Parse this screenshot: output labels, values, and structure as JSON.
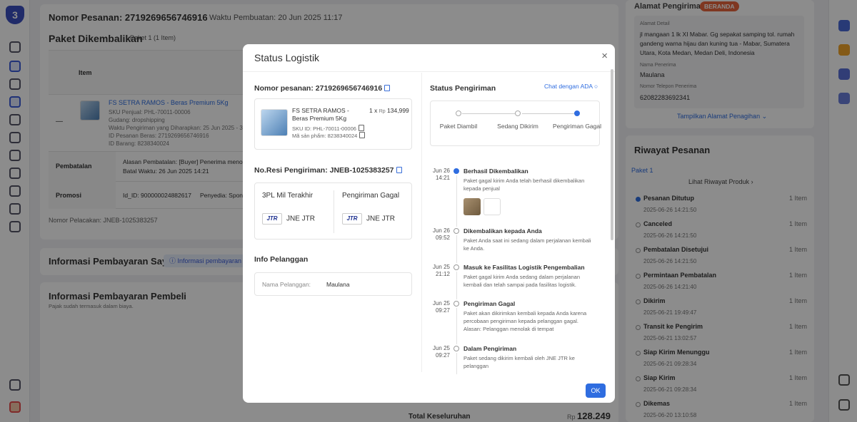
{
  "background": {
    "order": {
      "number_label": "Nomor Pesanan: 2719269656746916",
      "created": "Waktu Pembuatan: 20 Jun 2025 11:17"
    },
    "package": {
      "title": "Paket Dikembalikan",
      "subtitle": "Paket 1  (1 Item)",
      "col_item": "Item",
      "product_name": "FS SETRA RAMOS - Beras Premium 5Kg",
      "sku_seller": "SKU Penjual: PHL-70011-00006",
      "warehouse": "Gudang: dropshipping",
      "ship_time": "Waktu Pengiriman yang Diharapkan: 25 Jun 2025 - 30 Ju",
      "id_pesanan": "ID Pesanan Beras: 2719269656746916",
      "id_barang": "ID Barang: 8238340024",
      "row_pembatalan": "Pembatalan",
      "alasan": "Alasan Pembatalan: [Buyer] Penerima menol",
      "batas": "Batal Waktu: 26 Jun 2025 14:21",
      "row_promosi": "Promosi",
      "promo_id": "Id_ID: 900000024882617",
      "penyedia": "Penyedia: Spon",
      "tracking": "Nomor Pelacakan: JNEB-1025383257",
      "dash": "—"
    },
    "payment_mine": {
      "title": "Informasi Pembayaran Saya",
      "badge": "Informasi pembayaran"
    },
    "payment_buyer": {
      "title": "Informasi Pembayaran Pembeli",
      "note": "Pajak sudah termasuk dalam biaya.",
      "total_label": "Total Keseluruhan",
      "total_currency": "Rp",
      "total_value": "128.249"
    },
    "address": {
      "title": "Alamat Pengiriman",
      "badge": "BERANDA",
      "detail_label": "Alamat Detail",
      "detail": "jl mangaan 1 lk XI Mabar. Gg sepakat samping tol. rumah gandeng warna hijau dan kuning tua - Mabar, Sumatera Utara, Kota Medan, Medan Deli, Indonesia",
      "name_label": "Nama Penerima",
      "name": "Maulana",
      "phone_label": "Nomor Telepon Penerima",
      "phone": "62082283692341",
      "show_more": "Tampilkan Alamat Penagihan"
    },
    "history": {
      "title": "Riwayat Pesanan",
      "package": "Paket 1",
      "view_products": "Lihat Riwayat Produk",
      "items": [
        {
          "label": "Pesanan Ditutup",
          "time": "2025-06-26 14:21:50",
          "qty": "1 Item"
        },
        {
          "label": "Canceled",
          "time": "2025-06-26 14:21:50",
          "qty": "1 Item"
        },
        {
          "label": "Pembatalan Disetujui",
          "time": "2025-06-26 14:21:50",
          "qty": "1 Item"
        },
        {
          "label": "Permintaan Pembatalan",
          "time": "2025-06-26 14:21:40",
          "qty": "1 Item"
        },
        {
          "label": "Dikirim",
          "time": "2025-06-21 19:49:47",
          "qty": "1 Item"
        },
        {
          "label": "Transit ke Pengirim",
          "time": "2025-06-21 13:02:57",
          "qty": "1 Item"
        },
        {
          "label": "Siap Kirim Menunggu",
          "time": "2025-06-21 09:28:34",
          "qty": "1 Item"
        },
        {
          "label": "Siap Kirim",
          "time": "2025-06-21 09:28:34",
          "qty": "1 Item"
        },
        {
          "label": "Dikemas",
          "time": "2025-06-20 13:10:58",
          "qty": "1 Item"
        }
      ]
    }
  },
  "modal": {
    "title": "Status Logistik",
    "close": "×",
    "order_number": "Nomor pesanan: 2719269656746916",
    "product": {
      "name": "FS SETRA RAMOS - Beras Premium 5Kg",
      "qty": "1 x",
      "currency": "Rp",
      "price": "134,999",
      "sku": "SKU ID: PHL-70011-00006",
      "product_code": "Mã sản phẩm: 8238340024"
    },
    "resi": "No.Resi Pengiriman: JNEB-1025383257",
    "carrier": {
      "col1_label": "3PL Mil Terakhir",
      "col1_name": "JNE JTR",
      "col2_label": "Pengiriman Gagal",
      "col2_name": "JNE JTR",
      "logo_text": "JTR"
    },
    "customer": {
      "title": "Info Pelanggan",
      "name_label": "Nama Pelanggan:",
      "name": "Maulana"
    },
    "shipping_status": {
      "title": "Status Pengiriman",
      "chat": "Chat dengan ADA",
      "steps": [
        "Paket Diambil",
        "Sedang Dikirim",
        "Pengiriman Gagal"
      ]
    },
    "timeline": [
      {
        "date": "Jun 26",
        "time": "14:21",
        "title": "Berhasil Dikembalikan",
        "desc": "Paket gagal kirim Anda telah berhasil dikembalikan kepada penjual"
      },
      {
        "date": "Jun 26",
        "time": "09:52",
        "title": "Dikembalikan kepada Anda",
        "desc": "Paket Anda saat ini sedang dalam perjalanan kembali ke Anda."
      },
      {
        "date": "Jun 25",
        "time": "21:12",
        "title": "Masuk ke Fasilitas Logistik Pengembalian",
        "desc": "Paket gagal kirim Anda sedang dalam perjalanan kembali dan telah sampai pada fasilitas logistik."
      },
      {
        "date": "Jun 25",
        "time": "09:27",
        "title": "Pengiriman Gagal",
        "desc": "Paket akan dikirimkan kembali kepada Anda karena percobaan pengiriman kepada pelanggan gagal. Alasan: Pelanggan menolak di tempat"
      },
      {
        "date": "Jun 25",
        "time": "09:27",
        "title": "Dalam Pengiriman",
        "desc": "Paket sedang dikirim kembali oleh JNE JTR ke pelanggan"
      }
    ],
    "ok": "OK"
  },
  "colors": {
    "accent": "#2f6de0",
    "brand": "#3b4fbf",
    "badge": "#e8643c"
  }
}
